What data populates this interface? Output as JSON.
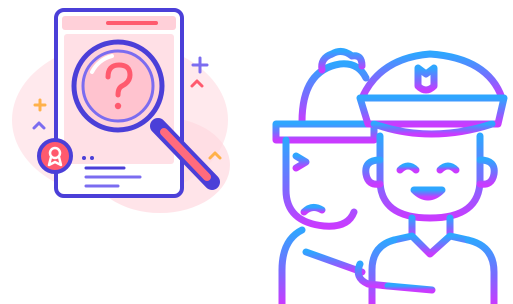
{
  "illustrations": [
    {
      "icon": "search-document-icon",
      "colors": {
        "outline": "#4b3fd8",
        "fill_light": "#ffe0e6",
        "fill_pink": "#ff9fb0",
        "accent_red": "#ff5a6e",
        "accent_orange": "#ffb14a",
        "accent_purple": "#7b6cf0",
        "lens_fill": "#ffd2da"
      }
    },
    {
      "icon": "worker-and-police-officer-icon",
      "colors": {
        "gradient_top": "#2ea6ff",
        "gradient_bottom": "#c93bff"
      }
    }
  ]
}
